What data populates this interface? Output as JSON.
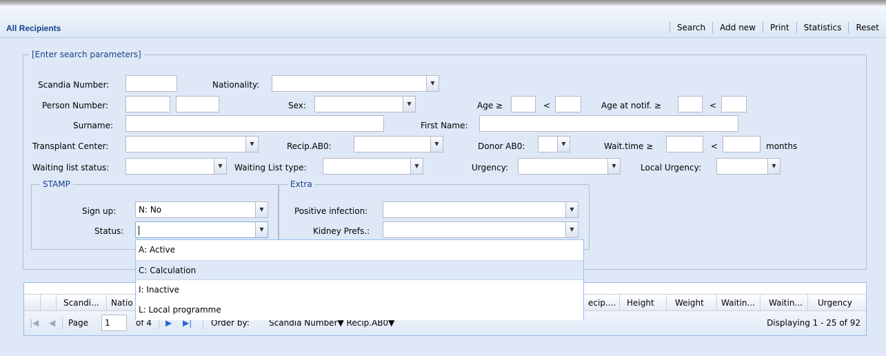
{
  "header": {
    "title": "All Recipients",
    "toolbar": [
      "Search",
      "Add new",
      "Print",
      "Statistics",
      "Reset"
    ]
  },
  "search": {
    "legend": "[Enter search parameters]",
    "labels": {
      "scandia_number": "Scandia Number:",
      "nationality": "Nationality:",
      "person_number": "Person Number:",
      "sex": "Sex:",
      "age": "Age ≥",
      "lt": "<",
      "age_notif": "Age at notif. ≥",
      "surname": "Surname:",
      "first_name": "First Name:",
      "transplant_center": "Transplant Center:",
      "recip_ab0": "Recip.AB0:",
      "donor_ab0": "Donor AB0:",
      "wait_time": "Wait.time ≥",
      "months": "months",
      "waiting_list_status": "Waiting list status:",
      "waiting_list_type": "Waiting List type:",
      "urgency": "Urgency:",
      "local_urgency": "Local Urgency:"
    }
  },
  "stamp": {
    "legend": "STAMP",
    "sign_up_label": "Sign up:",
    "sign_up_value": "N: No",
    "status_label": "Status:",
    "status_value": ""
  },
  "extra": {
    "legend": "Extra",
    "positive_infection_label": "Positive infection:",
    "kidney_prefs_label": "Kidney Prefs.:"
  },
  "status_dropdown": {
    "options": [
      "A: Active",
      "C: Calculation",
      "I: Inactive",
      "L: Local programme"
    ],
    "highlighted_index": 1
  },
  "grid": {
    "columns": [
      "Scandi...",
      "Natio",
      "ecip....",
      "Height",
      "Weight",
      "Waitin...",
      "Waitin...",
      "Urgency"
    ]
  },
  "paging": {
    "page_label": "Page",
    "page_value": "1",
    "of_label": "of 4",
    "order_by_label": "Order by:",
    "order_fields": "Scandia Number▼ Recip.AB0▼",
    "display_info": "Displaying 1 - 25 of 92"
  },
  "colors": {
    "title": "#15428b",
    "panel_bg": "#dfe8f6",
    "border": "#99bbe8"
  }
}
